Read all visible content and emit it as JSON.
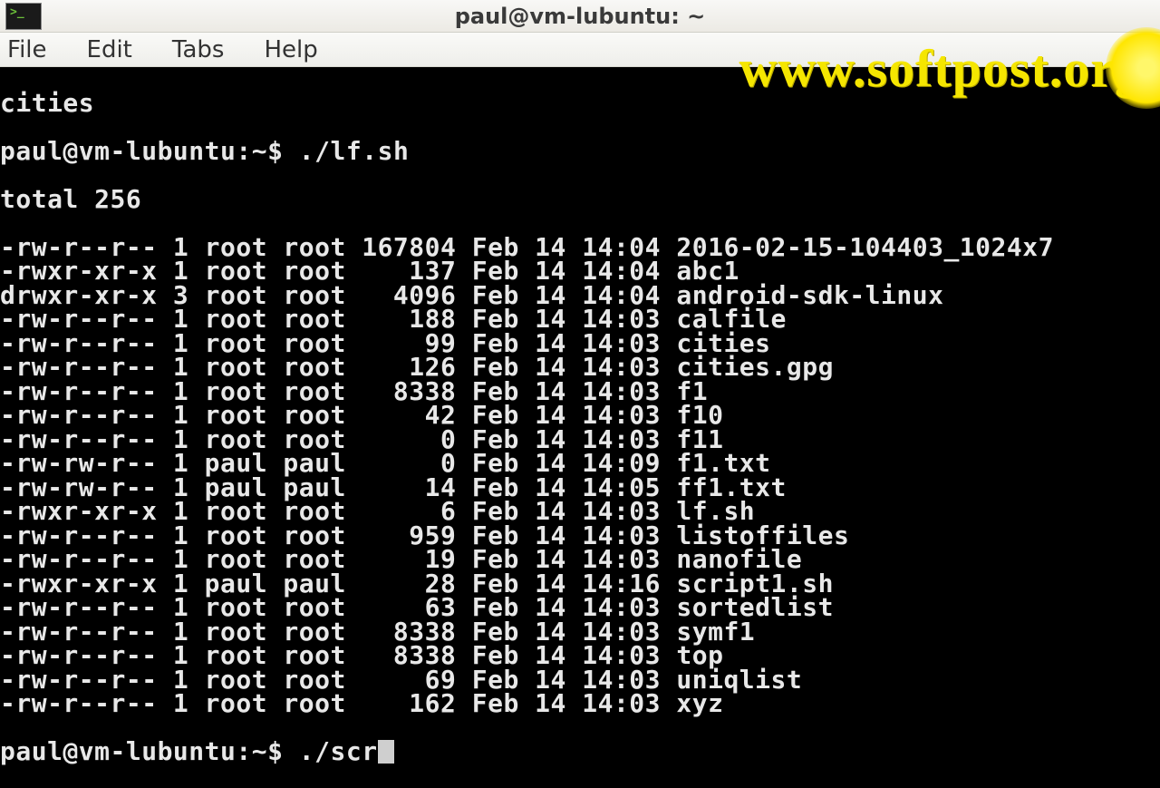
{
  "window": {
    "title": "paul@vm-lubuntu: ~"
  },
  "menu": {
    "file": "File",
    "edit": "Edit",
    "tabs": "Tabs",
    "help": "Help"
  },
  "watermark": "www.softpost.org",
  "terminal": {
    "scrollback_top": "cities",
    "prompt1": "paul@vm-lubuntu:~$ ",
    "cmd1": "./lf.sh",
    "total": "total 256",
    "listing": [
      {
        "perm": "-rw-r--r--",
        "links": "1",
        "owner": "root",
        "group": "root",
        "size": "167804",
        "month": "Feb",
        "day": "14",
        "time": "14:04",
        "name": "2016-02-15-104403_1024x7"
      },
      {
        "perm": "-rwxr-xr-x",
        "links": "1",
        "owner": "root",
        "group": "root",
        "size": "137",
        "month": "Feb",
        "day": "14",
        "time": "14:04",
        "name": "abc1"
      },
      {
        "perm": "drwxr-xr-x",
        "links": "3",
        "owner": "root",
        "group": "root",
        "size": "4096",
        "month": "Feb",
        "day": "14",
        "time": "14:04",
        "name": "android-sdk-linux"
      },
      {
        "perm": "-rw-r--r--",
        "links": "1",
        "owner": "root",
        "group": "root",
        "size": "188",
        "month": "Feb",
        "day": "14",
        "time": "14:03",
        "name": "calfile"
      },
      {
        "perm": "-rw-r--r--",
        "links": "1",
        "owner": "root",
        "group": "root",
        "size": "99",
        "month": "Feb",
        "day": "14",
        "time": "14:03",
        "name": "cities"
      },
      {
        "perm": "-rw-r--r--",
        "links": "1",
        "owner": "root",
        "group": "root",
        "size": "126",
        "month": "Feb",
        "day": "14",
        "time": "14:03",
        "name": "cities.gpg"
      },
      {
        "perm": "-rw-r--r--",
        "links": "1",
        "owner": "root",
        "group": "root",
        "size": "8338",
        "month": "Feb",
        "day": "14",
        "time": "14:03",
        "name": "f1"
      },
      {
        "perm": "-rw-r--r--",
        "links": "1",
        "owner": "root",
        "group": "root",
        "size": "42",
        "month": "Feb",
        "day": "14",
        "time": "14:03",
        "name": "f10"
      },
      {
        "perm": "-rw-r--r--",
        "links": "1",
        "owner": "root",
        "group": "root",
        "size": "0",
        "month": "Feb",
        "day": "14",
        "time": "14:03",
        "name": "f11"
      },
      {
        "perm": "-rw-rw-r--",
        "links": "1",
        "owner": "paul",
        "group": "paul",
        "size": "0",
        "month": "Feb",
        "day": "14",
        "time": "14:09",
        "name": "f1.txt"
      },
      {
        "perm": "-rw-rw-r--",
        "links": "1",
        "owner": "paul",
        "group": "paul",
        "size": "14",
        "month": "Feb",
        "day": "14",
        "time": "14:05",
        "name": "ff1.txt"
      },
      {
        "perm": "-rwxr-xr-x",
        "links": "1",
        "owner": "root",
        "group": "root",
        "size": "6",
        "month": "Feb",
        "day": "14",
        "time": "14:03",
        "name": "lf.sh"
      },
      {
        "perm": "-rw-r--r--",
        "links": "1",
        "owner": "root",
        "group": "root",
        "size": "959",
        "month": "Feb",
        "day": "14",
        "time": "14:03",
        "name": "listoffiles"
      },
      {
        "perm": "-rw-r--r--",
        "links": "1",
        "owner": "root",
        "group": "root",
        "size": "19",
        "month": "Feb",
        "day": "14",
        "time": "14:03",
        "name": "nanofile"
      },
      {
        "perm": "-rwxr-xr-x",
        "links": "1",
        "owner": "paul",
        "group": "paul",
        "size": "28",
        "month": "Feb",
        "day": "14",
        "time": "14:16",
        "name": "script1.sh"
      },
      {
        "perm": "-rw-r--r--",
        "links": "1",
        "owner": "root",
        "group": "root",
        "size": "63",
        "month": "Feb",
        "day": "14",
        "time": "14:03",
        "name": "sortedlist"
      },
      {
        "perm": "-rw-r--r--",
        "links": "1",
        "owner": "root",
        "group": "root",
        "size": "8338",
        "month": "Feb",
        "day": "14",
        "time": "14:03",
        "name": "symf1"
      },
      {
        "perm": "-rw-r--r--",
        "links": "1",
        "owner": "root",
        "group": "root",
        "size": "8338",
        "month": "Feb",
        "day": "14",
        "time": "14:03",
        "name": "top"
      },
      {
        "perm": "-rw-r--r--",
        "links": "1",
        "owner": "root",
        "group": "root",
        "size": "69",
        "month": "Feb",
        "day": "14",
        "time": "14:03",
        "name": "uniqlist"
      },
      {
        "perm": "-rw-r--r--",
        "links": "1",
        "owner": "root",
        "group": "root",
        "size": "162",
        "month": "Feb",
        "day": "14",
        "time": "14:03",
        "name": "xyz"
      }
    ],
    "prompt2": "paul@vm-lubuntu:~$ ",
    "cmd2": "./scr"
  },
  "faded_right": "xyz"
}
